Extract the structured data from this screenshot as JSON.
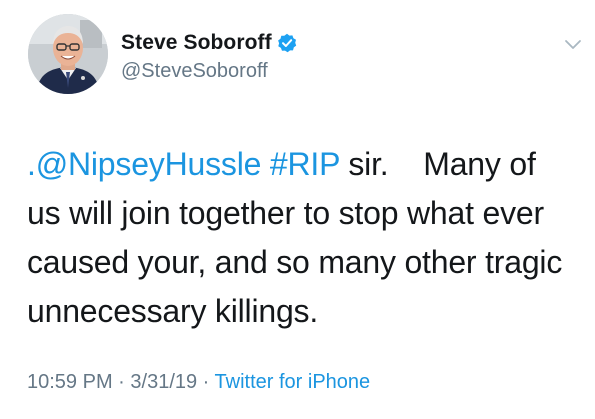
{
  "author": {
    "display_name": "Steve Soboroff",
    "handle": "@SteveSoboroff"
  },
  "icons": {
    "verified": "verified-badge-icon",
    "caret": "chevron-down-icon"
  },
  "tweet": {
    "prefix": ".",
    "mention": "@NipseyHussle",
    "hashtag": "#RIP",
    "after_hashtag": " sir.    Many of",
    "line2": "us will join together to stop what ever",
    "line3": "caused your, and so many other tragic",
    "line4": "unnecessary killings."
  },
  "meta": {
    "time": "10:59 PM",
    "separator": " · ",
    "date": "3/31/19",
    "separator2": " · ",
    "source": "Twitter for iPhone"
  },
  "colors": {
    "link": "#1b95e0",
    "secondary": "#657786",
    "text": "#14171a"
  }
}
